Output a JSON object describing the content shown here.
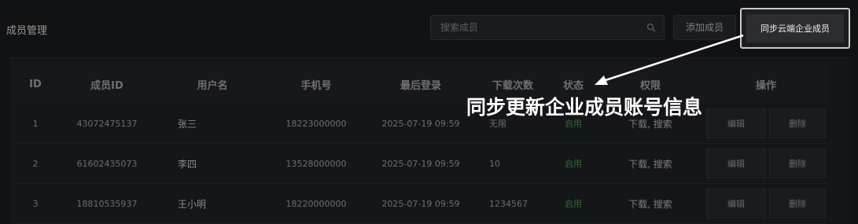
{
  "page_title": "成员管理",
  "search": {
    "placeholder": "搜索成员"
  },
  "toolbar": {
    "add_label": "添加成员",
    "sync_label": "同步云端企业成员"
  },
  "annotation": "同步更新企业成员账号信息",
  "table": {
    "headers": [
      "ID",
      "成员ID",
      "用户名",
      "手机号",
      "最后登录",
      "下载次数",
      "状态",
      "权限",
      "操作"
    ],
    "rows": [
      {
        "id": "1",
        "member_id": "43072475137",
        "username": "张三",
        "phone": "18223000000",
        "last_login": "2025-07-19 09:59",
        "downloads": "无限",
        "status": "启用",
        "permissions": "下载, 搜索",
        "edit": "编辑",
        "delete": "删除"
      },
      {
        "id": "2",
        "member_id": "61602435073",
        "username": "李四",
        "phone": "13528000000",
        "last_login": "2025-07-19 09:59",
        "downloads": "10",
        "status": "启用",
        "permissions": "下载, 搜索",
        "edit": "编辑",
        "delete": "删除"
      },
      {
        "id": "3",
        "member_id": "18810535937",
        "username": "王小明",
        "phone": "18220000000",
        "last_login": "2025-07-19 09:59",
        "downloads": "1234567",
        "status": "启用",
        "permissions": "下载, 搜索",
        "edit": "编辑",
        "delete": "删除"
      }
    ]
  },
  "colors": {
    "background": "#111214",
    "status_enabled": "#2f6a37",
    "annotation": "#ffffff"
  },
  "icons": {
    "search": "search-icon"
  }
}
